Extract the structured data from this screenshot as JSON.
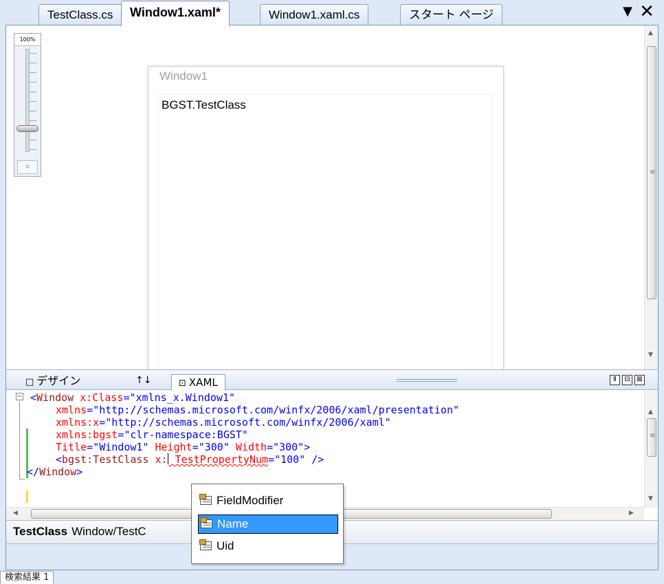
{
  "tabs": [
    {
      "label": "TestClass.cs",
      "active": false
    },
    {
      "label": "Window1.xaml*",
      "active": true
    },
    {
      "label": "Window1.xaml.cs",
      "active": false
    },
    {
      "label": "スタート ページ",
      "active": false
    }
  ],
  "tab_controls": {
    "menu_glyph": "▼",
    "close_glyph": "✕"
  },
  "designer": {
    "zoom_label": "100%",
    "zoom_fit_glyph": "⌗",
    "window_title": "Window1",
    "content_text": "BGST.TestClass"
  },
  "view_tabs": {
    "design_label": "デザイン",
    "design_icon": "□",
    "swap_label": "↑↓",
    "xaml_label": "XAML",
    "xaml_icon": "⊡"
  },
  "pane_buttons": [
    "Ⅱ",
    "⊟",
    "⊠"
  ],
  "code": {
    "fold_glyph": "−",
    "line1": {
      "p1": "<",
      "el": "Window",
      "at": " x:Class",
      "eq": "=",
      "val": "\"xmlns_x.Window1\""
    },
    "line2": {
      "at": "xmlns",
      "eq": "=",
      "val": "\"http://schemas.microsoft.com/winfx/2006/xaml/presentation\""
    },
    "line3": {
      "at": "xmlns:x",
      "eq": "=",
      "val": "\"http://schemas.microsoft.com/winfx/2006/xaml\""
    },
    "line4": {
      "at": "xmlns:bgst",
      "eq": "=",
      "val": "\"clr-namespace:BGST\""
    },
    "line5": {
      "at1": "Title",
      "eq1": "=",
      "val1": "\"Window1\"",
      "at2": " Height",
      "eq2": "=",
      "val2": "\"300\"",
      "at3": " Width",
      "eq3": "=",
      "val3": "\"300\"",
      "close": ">"
    },
    "line6": {
      "open": "<",
      "el": "bgst:TestClass",
      "at1": " x:",
      "at2": " TestPropertyNum",
      "eq": "=",
      "val": "\"100\"",
      "close": " />"
    },
    "line7": {
      "open": "</",
      "el": "Window",
      "close": ">"
    }
  },
  "breadcrumb": {
    "bold": "TestClass",
    "path": "Window/TestC"
  },
  "intellisense": {
    "items": [
      "FieldModifier",
      "Name",
      "Uid"
    ],
    "selected_index": 1
  },
  "find_tab": "検索結果 1",
  "colors": {
    "selection": "#3399ff",
    "xml_bracket": "#0000ff",
    "xml_element": "#a31515",
    "xml_attribute": "#ff0000",
    "xml_value": "#0000ff",
    "changed_bar": "#5cb85c",
    "unsaved_bar": "#ffd34d"
  }
}
